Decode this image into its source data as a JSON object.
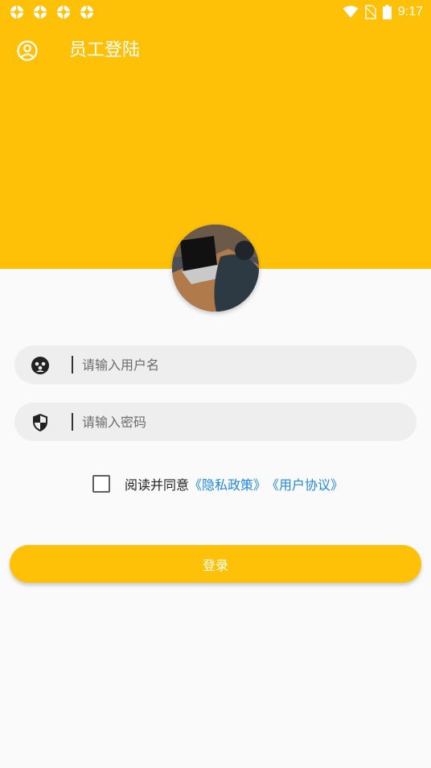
{
  "status_bar": {
    "time": "9:17",
    "icons": [
      "notification-icon",
      "notification-icon",
      "notification-icon",
      "notification-icon",
      "wifi-icon",
      "no-sim-icon",
      "battery-icon"
    ]
  },
  "toolbar": {
    "title": "员工登陆",
    "icon": "account-circle-icon"
  },
  "avatar": {
    "description_icon": "person-at-laptop-photo"
  },
  "form": {
    "username": {
      "placeholder": "请输入用户名",
      "value": "",
      "icon": "user-group-icon"
    },
    "password": {
      "placeholder": "请输入密码",
      "value": "",
      "icon": "shield-icon"
    }
  },
  "agreement": {
    "checked": false,
    "prefix": "阅读并同意",
    "privacy_link": "《隐私政策》",
    "terms_link": "《用户协议》"
  },
  "login_button": {
    "label": "登录"
  },
  "colors": {
    "primary": "#FFC107",
    "link": "#1E88E5",
    "background": "#FAFAFA"
  }
}
